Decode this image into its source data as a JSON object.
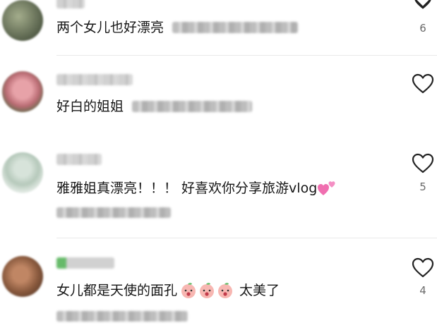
{
  "comments": [
    {
      "text": "两个女儿也好漂亮",
      "like_count": "6",
      "avatar_color": "#6f7a5e"
    },
    {
      "text": "好白的姐姐",
      "like_count": "",
      "avatar_color": "#c98a8f"
    },
    {
      "text_main": "雅雅姐真漂亮！！！ 好喜欢你分享旅游vlog",
      "trailing_emoji": "pink-hearts-emoji",
      "like_count": "5",
      "avatar_color": "#e8efe9"
    },
    {
      "text_main": "女儿都是天使的面孔",
      "face_emoji": "peach-face-emoji",
      "face_emoji_count": 3,
      "text_after": "太美了",
      "like_count": "4",
      "avatar_color": "#8a5a3e"
    }
  ],
  "colors": {
    "text": "#161616",
    "count": "#6a6a6a",
    "icon_stroke": "#222222",
    "emoji_heart": "#f06fb0"
  },
  "icons": {
    "like": "heart-outline-icon",
    "top_partial": "chevron-down-icon"
  }
}
